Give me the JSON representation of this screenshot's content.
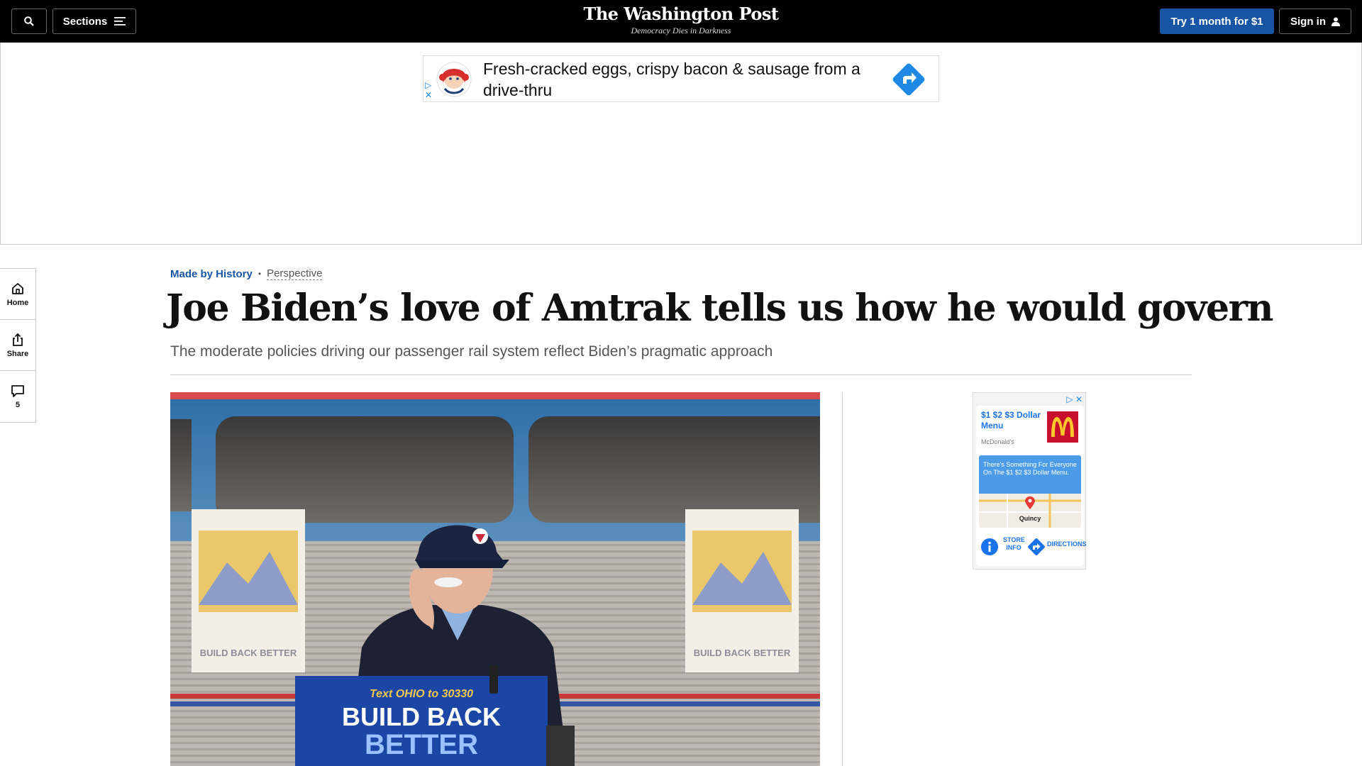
{
  "nav": {
    "sections_label": "Sections",
    "logo": "The Washington Post",
    "tagline": "Democracy Dies in Darkness",
    "try_label": "Try 1 month for $1",
    "signin_label": "Sign in"
  },
  "top_ad": {
    "text": "Fresh-cracked eggs, crispy bacon & sausage from a drive-thru"
  },
  "rail": {
    "home_label": "Home",
    "share_label": "Share",
    "comments_count": "5"
  },
  "article": {
    "section": "Made by History",
    "label": "Perspective",
    "headline": "Joe Biden’s love of Amtrak tells us how he would govern",
    "dek": "The moderate policies driving our passenger rail system reflect Biden’s pragmatic approach"
  },
  "photo": {
    "sign_line1": "Text OHIO to 30330",
    "sign_line2": "BUILD BACK",
    "sign_line3": "BETTER",
    "poster_caption": "BUILD BACK BETTER"
  },
  "side_ad": {
    "title": "$1 $2 $3 Dollar Menu",
    "brand": "McDonald's",
    "promo": "There's Something For Everyone On The $1 $2 $3 Dollar Menu.",
    "map_city": "Quincy",
    "store_info": "STORE INFO",
    "directions": "DIRECTIONS"
  },
  "colors": {
    "nav_bg": "#000000",
    "accent_blue": "#1955a5",
    "headline": "#111111",
    "dek": "#555555"
  }
}
